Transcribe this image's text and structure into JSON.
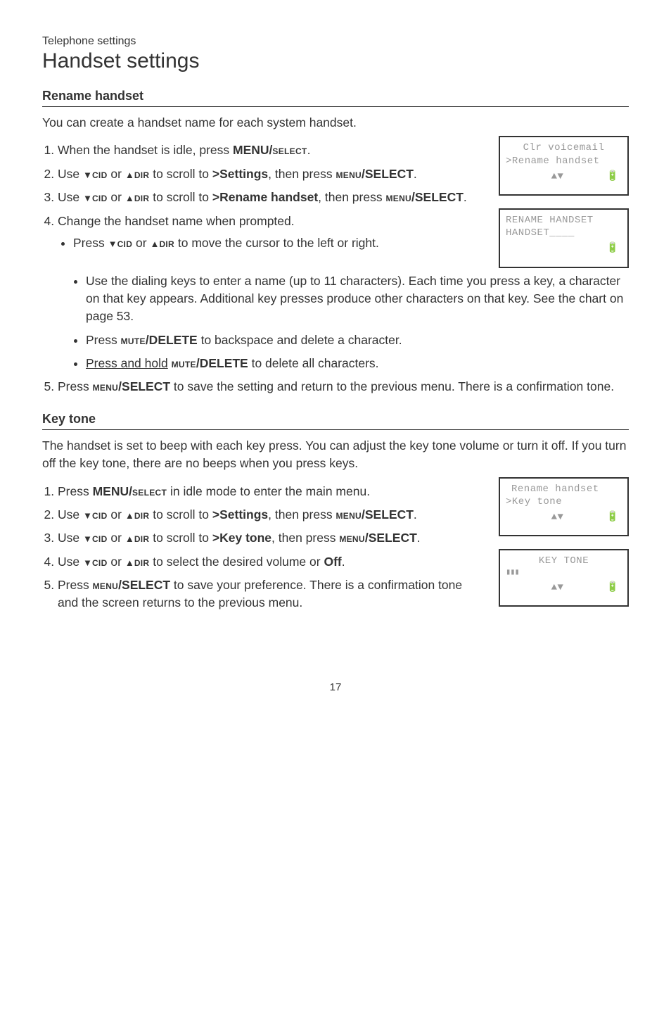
{
  "header": {
    "category": "Telephone settings",
    "title": "Handset settings"
  },
  "section1": {
    "title": "Rename handset",
    "intro": "You can create a handset name for each system handset.",
    "step1_a": "When the handset is idle, press ",
    "step1_b": "MENU/",
    "step1_c": "select",
    "step1_d": ".",
    "step2_a": "Use ",
    "step2_b": "cid",
    "step2_c": " or ",
    "step2_d": "dir",
    "step2_e": " to scroll to ",
    "step2_f": ">Settings",
    "step2_g": ", then press ",
    "step2_h": "menu",
    "step2_i": "/SELECT",
    "step2_j": ".",
    "step3_a": "Use ",
    "step3_b": "cid",
    "step3_c": " or ",
    "step3_d": "dir",
    "step3_e": " to scroll to ",
    "step3_f": ">Rename handset",
    "step3_g": ", then press ",
    "step3_h": "menu",
    "step3_i": "/SELECT",
    "step3_j": ".",
    "step4": "Change the handset name when prompted.",
    "b1_a": "Press ",
    "b1_b": "cid",
    "b1_c": " or ",
    "b1_d": "dir",
    "b1_e": " to move the cursor to the left or right.",
    "b2": "Use the dialing keys to enter a name (up to 11 characters). Each time you press a key, a character on that key appears. Additional key presses produce other characters on that key. See the chart on page 53.",
    "b3_a": "Press ",
    "b3_b": "mute",
    "b3_c": "/DELETE",
    "b3_d": " to backspace and delete a character.",
    "b4_a": "Press and hold",
    "b4_b": " ",
    "b4_c": "mute",
    "b4_d": "/DELETE",
    "b4_e": " to delete all characters.",
    "step5_a": "Press ",
    "step5_b": "menu",
    "step5_c": "/SELECT",
    "step5_d": " to save the setting and return to the previous menu. There is a confirmation tone.",
    "screen1": {
      "line1": "Clr voicemail",
      "line2": ">Rename handset"
    },
    "screen2": {
      "line1": "RENAME HANDSET",
      "line2": "HANDSET____"
    }
  },
  "section2": {
    "title": "Key tone",
    "intro": "The handset is set to beep with each key press. You can adjust the key tone volume or turn it off. If you turn off the key tone, there are no beeps when you press keys.",
    "step1_a": "Press ",
    "step1_b": "MENU/",
    "step1_c": "select",
    "step1_d": " in idle mode to enter the main menu.",
    "step2_a": "Use ",
    "step2_b": "cid",
    "step2_c": " or ",
    "step2_d": "dir",
    "step2_e": " to scroll to ",
    "step2_f": ">Settings",
    "step2_g": ", then press ",
    "step2_h": "menu",
    "step2_i": "/SELECT",
    "step2_j": ".",
    "step3_a": "Use ",
    "step3_b": "cid",
    "step3_c": " or ",
    "step3_d": "dir",
    "step3_e": " to scroll to ",
    "step3_f": ">Key tone",
    "step3_g": ", then press ",
    "step3_h": "menu",
    "step3_i": "/SELECT",
    "step3_j": ".",
    "step4_a": "Use ",
    "step4_b": "cid",
    "step4_c": " or ",
    "step4_d": "dir",
    "step4_e": " to select the desired volume or ",
    "step4_f": "Off",
    "step4_g": ".",
    "step5_a": "Press ",
    "step5_b": "menu",
    "step5_c": "/SELECT",
    "step5_d": " to save your preference. There is a confirmation tone and the screen returns to the previous menu.",
    "screen1": {
      "line1": "Rename handset",
      "line2": ">Key tone"
    },
    "screen2": {
      "line1": "KEY TONE"
    }
  },
  "icons": {
    "arrows": "▲▼",
    "battery": "🔋",
    "bars": "▮▮▮"
  },
  "page_number": "17"
}
